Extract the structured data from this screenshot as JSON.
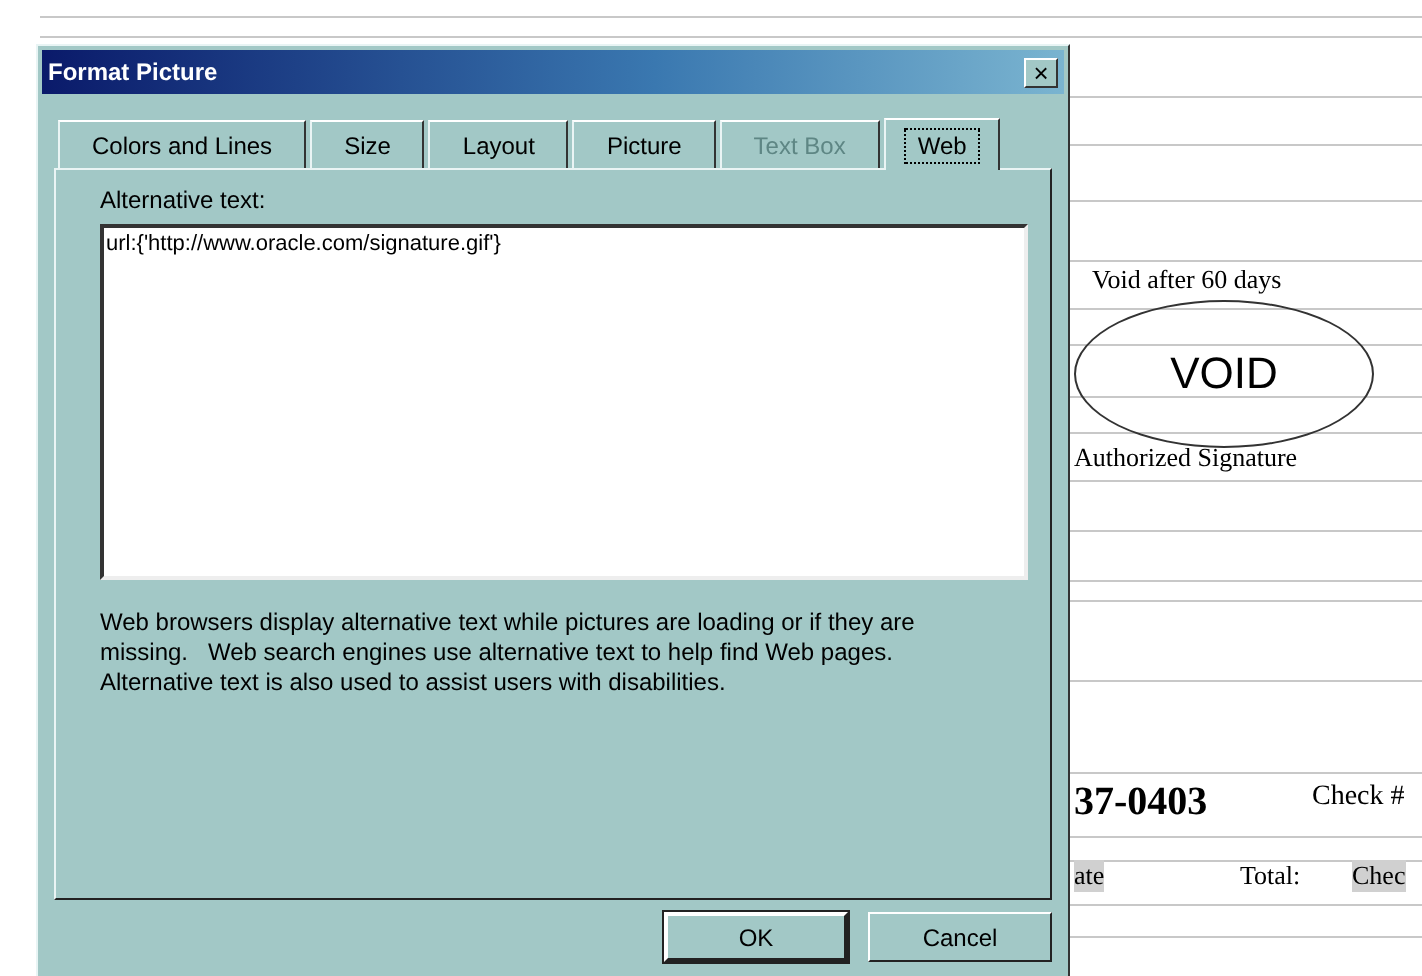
{
  "document": {
    "void_note": "Void after 60 days",
    "void_stamp": "VOID",
    "signature_label": "Authorized Signature",
    "phone_number": "37-0403",
    "check_label": "Check #",
    "row_cells": [
      {
        "text": "ate",
        "shaded": true
      },
      {
        "text": "Total:",
        "shaded": false
      },
      {
        "text": "Chec",
        "shaded": true
      }
    ]
  },
  "dialog": {
    "title": "Format Picture",
    "close": "×",
    "tabs": [
      {
        "label": "Colors and Lines",
        "selected": false,
        "disabled": false
      },
      {
        "label": "Size",
        "selected": false,
        "disabled": false
      },
      {
        "label": "Layout",
        "selected": false,
        "disabled": false
      },
      {
        "label": "Picture",
        "selected": false,
        "disabled": false
      },
      {
        "label": "Text Box",
        "selected": false,
        "disabled": true
      },
      {
        "label": "Web",
        "selected": true,
        "disabled": false
      }
    ],
    "alt_text_label": "Alternative text:",
    "alt_text_value": "url:{'http://www.oracle.com/signature.gif'}",
    "description": "Web browsers display alternative text while pictures are loading or if they are missing.   Web search engines use alternative text to help find Web pages.  Alternative text is also used to assist users with disabilities.",
    "buttons": [
      {
        "label": "OK",
        "default": true
      },
      {
        "label": "Cancel",
        "default": false
      }
    ]
  }
}
